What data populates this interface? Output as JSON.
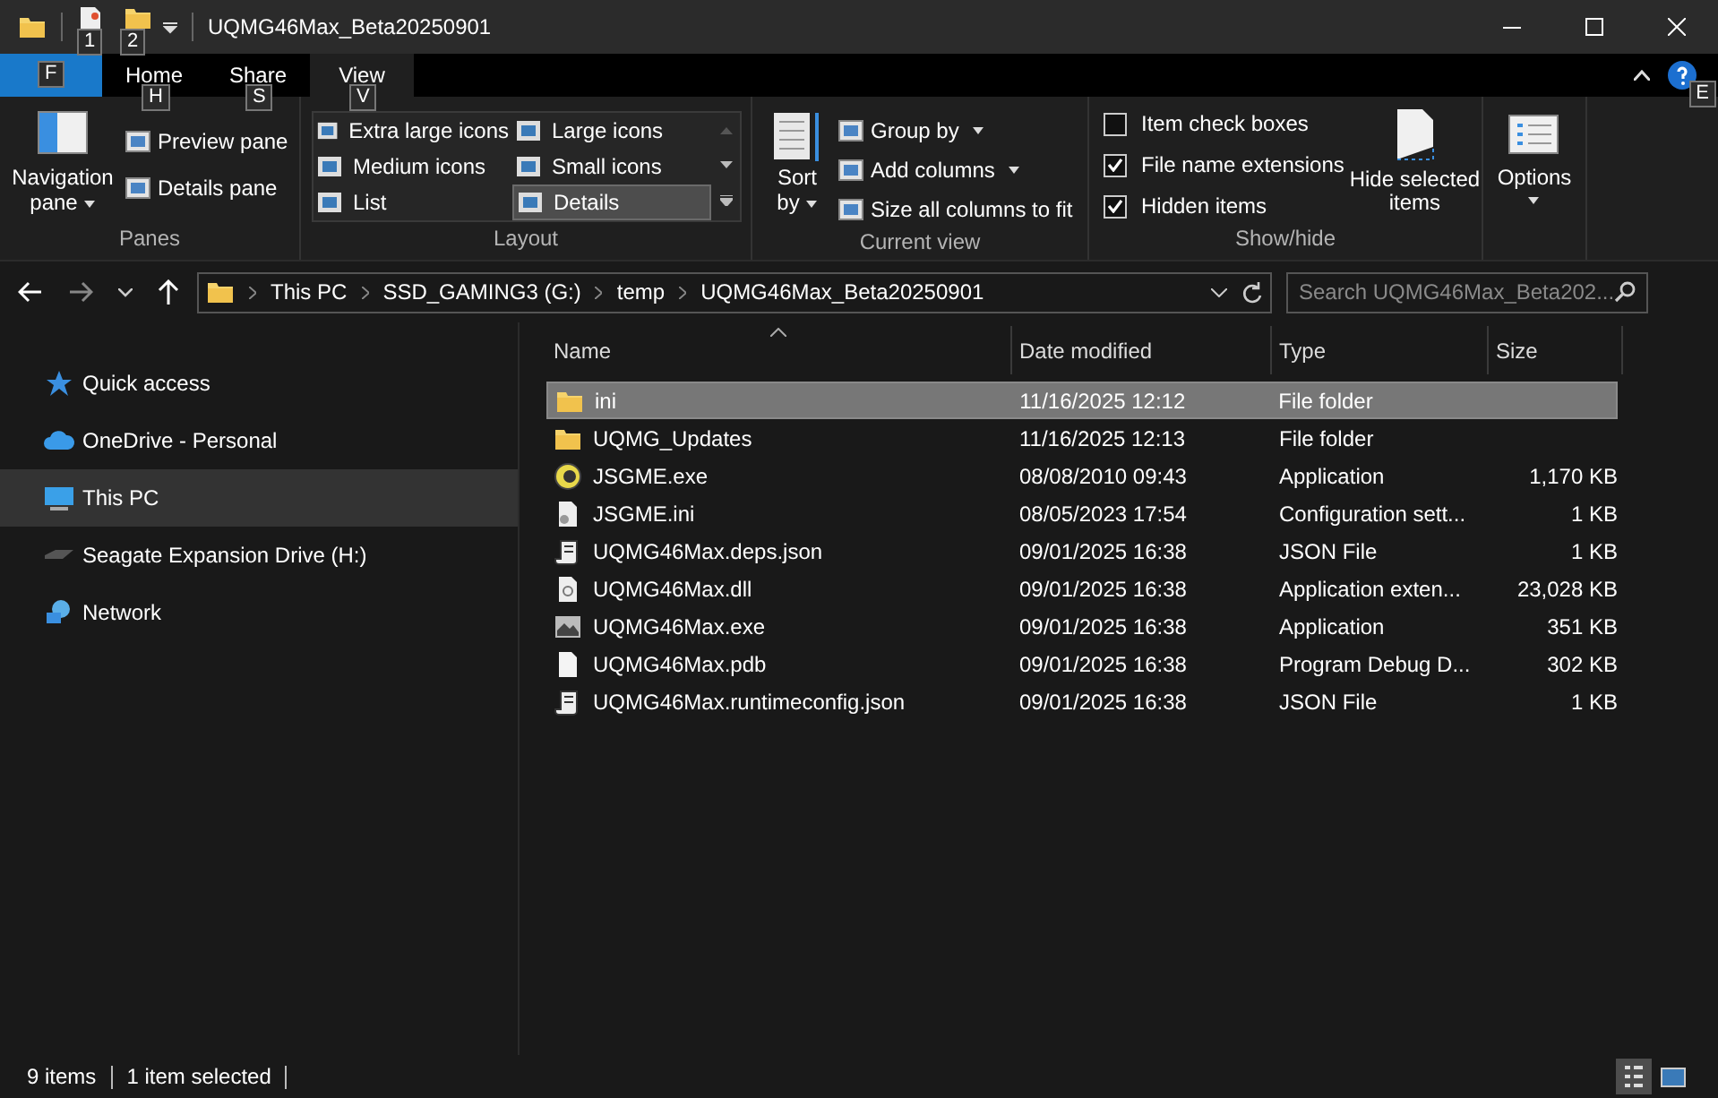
{
  "title_bar": {
    "keytips": [
      "1",
      "2"
    ],
    "title": "UQMG46Max_Beta20250901"
  },
  "ribbon_tabs": [
    {
      "kind": "file",
      "keytip": "F",
      "selected": false
    },
    {
      "kind": "tab",
      "label": "Home",
      "keytip": "H",
      "selected": false
    },
    {
      "kind": "tab",
      "label": "Share",
      "keytip": "S",
      "selected": false
    },
    {
      "kind": "tab",
      "label": "View",
      "keytip": "V",
      "selected": true
    }
  ],
  "help_keytip": "E",
  "panes": {
    "navigation_pane": "Navigation pane",
    "preview_pane": "Preview pane",
    "details_pane": "Details pane",
    "label": "Panes"
  },
  "layout": {
    "options": [
      {
        "label": "Extra large icons",
        "selected": false
      },
      {
        "label": "Large icons",
        "selected": false
      },
      {
        "label": "Medium icons",
        "selected": false
      },
      {
        "label": "Small icons",
        "selected": false
      },
      {
        "label": "List",
        "selected": false
      },
      {
        "label": "Details",
        "selected": true
      }
    ],
    "label": "Layout"
  },
  "current_view": {
    "sort_by": "Sort by",
    "group_by": "Group by",
    "add_columns": "Add columns",
    "size_columns": "Size all columns to fit",
    "label": "Current view"
  },
  "show_hide": {
    "checkboxes": [
      {
        "label": "Item check boxes",
        "checked": false
      },
      {
        "label": "File name extensions",
        "checked": true
      },
      {
        "label": "Hidden items",
        "checked": true
      }
    ],
    "hide_selected": "Hide selected items",
    "label": "Show/hide"
  },
  "options": "Options",
  "address_bar": {
    "breadcrumbs": [
      "This PC",
      "SSD_GAMING3 (G:)",
      "temp",
      "UQMG46Max_Beta20250901"
    ],
    "search_placeholder": "Search UQMG46Max_Beta202..."
  },
  "nav_pane": [
    {
      "kind": "star",
      "label": "Quick access",
      "selected": false
    },
    {
      "kind": "cloud",
      "label": "OneDrive - Personal",
      "selected": false
    },
    {
      "kind": "pc",
      "label": "This PC",
      "selected": true
    },
    {
      "kind": "drive",
      "label": "Seagate Expansion Drive (H:)",
      "selected": false
    },
    {
      "kind": "network",
      "label": "Network",
      "selected": false
    }
  ],
  "columns": [
    "Name",
    "Date modified",
    "Type",
    "Size"
  ],
  "rows": [
    {
      "kind": "folder",
      "name": "ini",
      "date": "11/16/2025 12:12",
      "type": "File folder",
      "selected": true
    },
    {
      "kind": "folder",
      "name": "UQMG_Updates",
      "date": "11/16/2025 12:13",
      "type": "File folder",
      "selected": false
    },
    {
      "kind": "app",
      "name": "JSGME.exe",
      "date": "08/08/2010 09:43",
      "type": "Application",
      "size": "1,170 KB",
      "selected": false
    },
    {
      "kind": "settings",
      "name": "JSGME.ini",
      "date": "08/05/2023 17:54",
      "type": "Configuration sett...",
      "size": "1 KB",
      "selected": false
    },
    {
      "kind": "script",
      "name": "UQMG46Max.deps.json",
      "date": "09/01/2025 16:38",
      "type": "JSON File",
      "size": "1 KB",
      "selected": false
    },
    {
      "kind": "library",
      "name": "UQMG46Max.dll",
      "date": "09/01/2025 16:38",
      "type": "Application exten...",
      "size": "23,028 KB",
      "selected": false
    },
    {
      "kind": "exe",
      "name": "UQMG46Max.exe",
      "date": "09/01/2025 16:38",
      "type": "Application",
      "size": "351 KB",
      "selected": false
    },
    {
      "kind": "blank",
      "name": "UQMG46Max.pdb",
      "date": "09/01/2025 16:38",
      "type": "Program Debug D...",
      "size": "302 KB",
      "selected": false
    },
    {
      "kind": "script",
      "name": "UQMG46Max.runtimeconfig.json",
      "date": "09/01/2025 16:38",
      "type": "JSON File",
      "size": "1 KB",
      "selected": false
    }
  ],
  "status_bar": [
    "9 items",
    "1 item selected"
  ]
}
